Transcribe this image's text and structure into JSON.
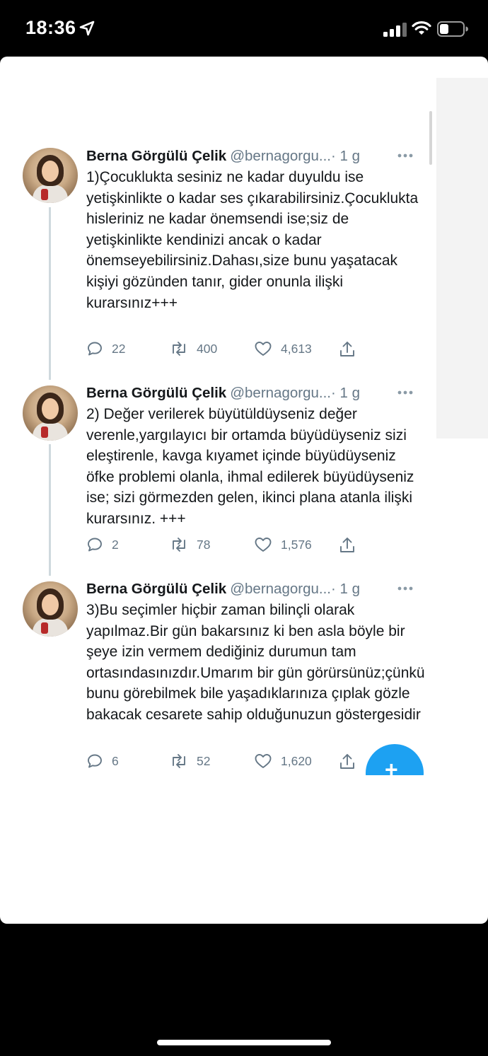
{
  "status_bar": {
    "time": "18:36"
  },
  "tweets": [
    {
      "name": "Berna Görgülü Çelik",
      "handle": "@bernagorgu...",
      "time": "· 1 g",
      "text": "1)Çocuklukta sesiniz ne kadar duyuldu ise yetişkinlikte o kadar ses çıkarabilirsiniz.Çocuklukta hisleriniz ne kadar önemsendi ise;siz de yetişkinlikte kendinizi ancak o kadar önemseyebilirsiniz.Dahası,size bunu yaşatacak kişiyi gözünden tanır, gider onunla ilişki kurarsınız+++",
      "replies": "22",
      "retweets": "400",
      "likes": "4,613"
    },
    {
      "name": "Berna Görgülü Çelik",
      "handle": "@bernagorgu...",
      "time": "· 1 g",
      "text": "2) Değer verilerek büyütüldüyseniz değer verenle,yargılayıcı bir ortamda büyüdüyseniz sizi eleştirenle, kavga kıyamet içinde büyüdüyseniz öfke problemi olanla, ihmal edilerek büyüdüyseniz ise;  sizi görmezden gelen, ikinci plana atanla ilişki kurarsınız. +++",
      "replies": "2",
      "retweets": "78",
      "likes": "1,576"
    },
    {
      "name": "Berna Görgülü Çelik",
      "handle": "@bernagorgu...",
      "time": "· 1 g",
      "text": "3)Bu seçimler hiçbir zaman bilinçli olarak yapılmaz.Bir gün bakarsınız ki ben asla böyle bir şeye izin vermem dediğiniz durumun tam ortasındasınızdır.Umarım bir gün görürsünüz;çünkü bunu görebilmek bile yaşadıklarınıza çıplak gözle bakacak cesarete sahip olduğunuzun göstergesidir",
      "replies": "6",
      "retweets": "52",
      "likes": "1,620"
    }
  ],
  "fab": {
    "label": "+"
  },
  "colors": {
    "accent": "#1da1f2",
    "text": "#14171a",
    "muted": "#657786",
    "thread_line": "#cfd9de"
  },
  "icons": [
    "navigation-arrow-icon",
    "signal-icon",
    "wifi-icon",
    "battery-icon",
    "more-icon",
    "reply-icon",
    "retweet-icon",
    "like-icon",
    "share-icon",
    "compose-icon"
  ]
}
